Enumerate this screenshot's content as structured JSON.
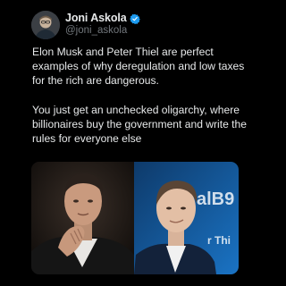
{
  "post": {
    "author": {
      "display_name": "Joni Askola",
      "handle": "@joni_askola",
      "verified": true,
      "verified_color": "#1d9bf0"
    },
    "paragraphs": [
      "Elon Musk and Peter Thiel are perfect examples of why deregulation and low taxes for the rich are dangerous.",
      "You just get an unchecked oligarchy, where billionaires buy the government and write the rules for everyone else"
    ],
    "media": {
      "images": [
        {
          "icon": "photo-elon-musk"
        },
        {
          "icon": "photo-peter-thiel",
          "backdrop_text": "alB9",
          "backdrop_text_2": "r Thi"
        }
      ]
    }
  },
  "colors": {
    "background": "#000000",
    "text": "#e7e9ea",
    "secondary_text": "#71767b"
  }
}
